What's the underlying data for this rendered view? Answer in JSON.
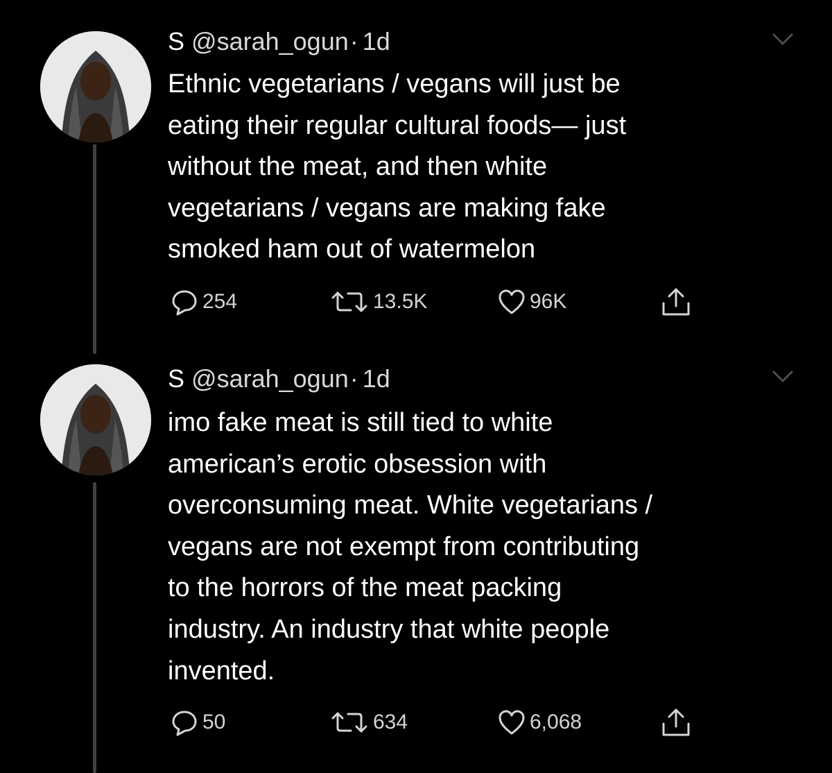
{
  "tweets": [
    {
      "display_name": "S",
      "handle": "@sarah_ogun",
      "separator": "·",
      "time": "1d",
      "text": "Ethnic vegetarians / vegans will just be\neating their regular cultural foods— just\nwithout the meat, and then white\nvegetarians / vegans are making fake\nsmoked ham out of watermelon",
      "replies": "254",
      "retweets": "13.5K",
      "likes": "96K"
    },
    {
      "display_name": "S",
      "handle": "@sarah_ogun",
      "separator": "·",
      "time": "1d",
      "text": "imo fake meat is still tied to white\namerican’s erotic obsession with\noverconsuming meat. White vegetarians /\nvegans are not exempt from contributing\nto the horrors of the meat packing\nindustry. An industry that white people\ninvented.",
      "replies": "50",
      "retweets": "634",
      "likes": "6,068"
    }
  ],
  "icons": {
    "reply": "speech-bubble-icon",
    "retweet": "retweet-arrows-icon",
    "like": "heart-icon",
    "share": "share-upload-icon",
    "menu": "chevron-down-icon"
  },
  "colors": {
    "background": "#000000",
    "text": "#ffffff",
    "secondary": "#d9d9d9",
    "icon": "#d4d4d4",
    "thread_line": "#3d4247"
  }
}
